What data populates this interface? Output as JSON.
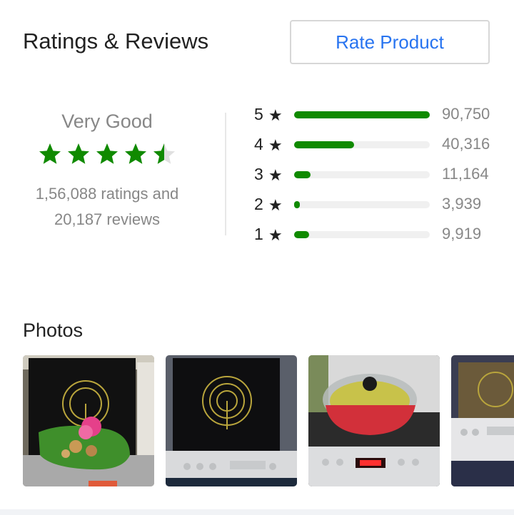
{
  "header": {
    "title": "Ratings & Reviews",
    "rate_button": "Rate Product"
  },
  "summary": {
    "verdict": "Very Good",
    "stars": 4.5,
    "star_color": "#108a00",
    "ratings_line": "1,56,088 ratings and",
    "reviews_line": "20,187 reviews"
  },
  "breakdown": [
    {
      "level": "5",
      "star": "★",
      "count": "90,750",
      "fraction": 1.0
    },
    {
      "level": "4",
      "star": "★",
      "count": "40,316",
      "fraction": 0.444
    },
    {
      "level": "3",
      "star": "★",
      "count": "11,164",
      "fraction": 0.123
    },
    {
      "level": "2",
      "star": "★",
      "count": "3,939",
      "fraction": 0.043
    },
    {
      "level": "1",
      "star": "★",
      "count": "9,919",
      "fraction": 0.109
    }
  ],
  "bar_color": "#108a00",
  "photos": {
    "title": "Photos",
    "items": [
      {
        "name": "photo-induction-cooktop-with-leaf-plate"
      },
      {
        "name": "photo-induction-cooktop-top-view"
      },
      {
        "name": "photo-pot-on-induction-cooktop"
      },
      {
        "name": "photo-induction-cooktop-partial"
      }
    ]
  }
}
